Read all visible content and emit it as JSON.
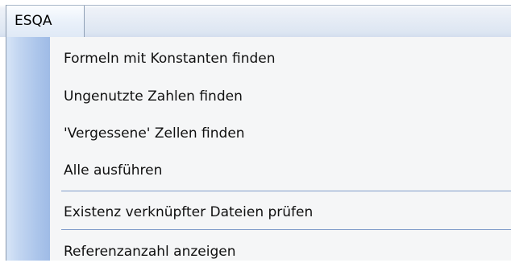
{
  "menubar": {
    "menu_title": "ESQA"
  },
  "dropdown": {
    "items": [
      {
        "label": "Formeln mit Konstanten finden"
      },
      {
        "label": "Ungenutzte Zahlen finden"
      },
      {
        "label": "'Vergessene' Zellen finden"
      },
      {
        "label": "Alle ausführen"
      },
      {
        "label": "Existenz verknüpfter Dateien prüfen"
      },
      {
        "label": "Referenzanzahl anzeigen"
      }
    ]
  }
}
